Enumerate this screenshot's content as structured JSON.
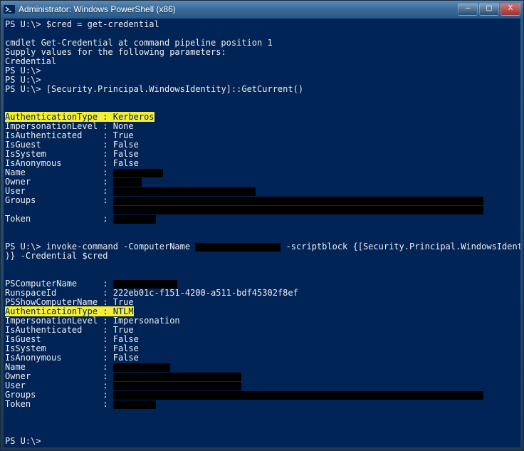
{
  "window": {
    "title": "Administrator: Windows PowerShell (x86)",
    "icon_name": "powershell-icon"
  },
  "buttons": {
    "minimize": "–",
    "maximize": "▢",
    "close": "X"
  },
  "console": {
    "prompt": "PS U:\\>",
    "cmd1": "$cred = get-credential",
    "msg1": "cmdlet Get-Credential at command pipeline position 1",
    "msg2": "Supply values for the following parameters:",
    "msg3": "Credential",
    "cmd2": "[Security.Principal.WindowsIdentity]::GetCurrent()",
    "sep": ":",
    "block1": {
      "AuthenticationType_label": "AuthenticationType",
      "AuthenticationType_value": "Kerberos",
      "ImpersonationLevel_label": "ImpersonationLevel",
      "ImpersonationLevel_value": "None",
      "IsAuthenticated_label": "IsAuthenticated",
      "IsAuthenticated_value": "True",
      "IsGuest_label": "IsGuest",
      "IsGuest_value": "False",
      "IsSystem_label": "IsSystem",
      "IsSystem_value": "False",
      "IsAnonymous_label": "IsAnonymous",
      "IsAnonymous_value": "False",
      "Name_label": "Name",
      "Owner_label": "Owner",
      "User_label": "User",
      "Groups_label": "Groups",
      "Token_label": "Token"
    },
    "cmd3_a": "invoke-command -ComputerName",
    "cmd3_b": "-scriptblock {[Security.Principal.WindowsIdentity]::GetCurrent(",
    "cmd3_c": ")} -Credential $cred",
    "block2": {
      "PSComputerName_label": "PSComputerName",
      "RunspaceId_label": "RunspaceId",
      "RunspaceId_value": "222eb01c-f151-4200-a511-bdf45302f8ef",
      "PSShowComputerName_label": "PSShowComputerName",
      "PSShowComputerName_value": "True",
      "AuthenticationType_label": "AuthenticationType",
      "AuthenticationType_value": "NTLM",
      "ImpersonationLevel_label": "ImpersonationLevel",
      "ImpersonationLevel_value": "Impersonation",
      "IsAuthenticated_label": "IsAuthenticated",
      "IsAuthenticated_value": "True",
      "IsGuest_label": "IsGuest",
      "IsGuest_value": "False",
      "IsSystem_label": "IsSystem",
      "IsSystem_value": "False",
      "IsAnonymous_label": "IsAnonymous",
      "IsAnonymous_value": "False",
      "Name_label": "Name",
      "Owner_label": "Owner",
      "User_label": "User",
      "Groups_label": "Groups",
      "Token_label": "Token"
    }
  }
}
